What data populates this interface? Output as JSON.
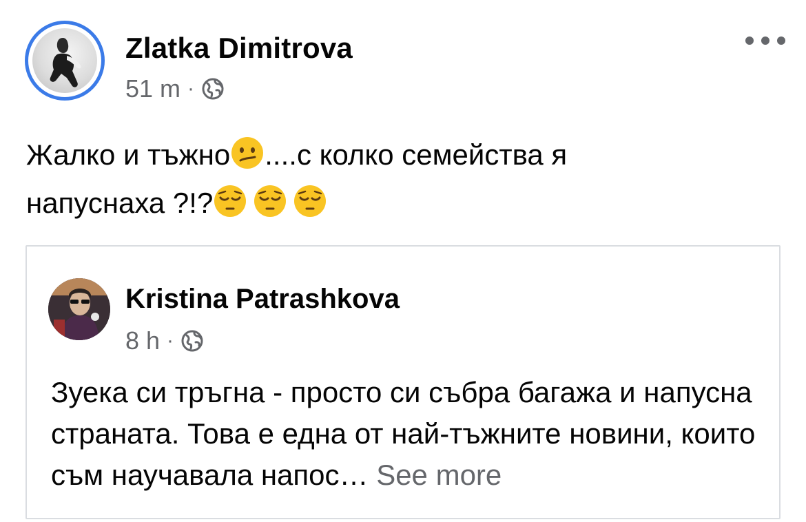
{
  "post": {
    "author_name": "Zlatka Dimitrova",
    "time": "51 m",
    "separator": "·",
    "privacy_icon": "globe-icon",
    "more_icon": "more-dots-icon",
    "text_part1": "Жалко и тъжно",
    "text_part2": "....с колко семейства я",
    "text_part3": "напуснаха ?!?",
    "emoji_confused": "confused-face-emoji",
    "emoji_pensive": "pensive-face-emoji"
  },
  "shared": {
    "author_name": "Kristina Patrashkova",
    "time": "8 h",
    "separator": "·",
    "privacy_icon": "globe-icon",
    "text": "Зуека си тръгна - просто си събра багажа и напусна страната. Това е една от най-тъжните новини, които съм научавала напос…",
    "see_more": "See more"
  },
  "colors": {
    "avatar_ring": "#3b7be8",
    "secondary_text": "#65676b",
    "card_border": "#dadde1",
    "emoji_yellow": "#f9c423"
  }
}
